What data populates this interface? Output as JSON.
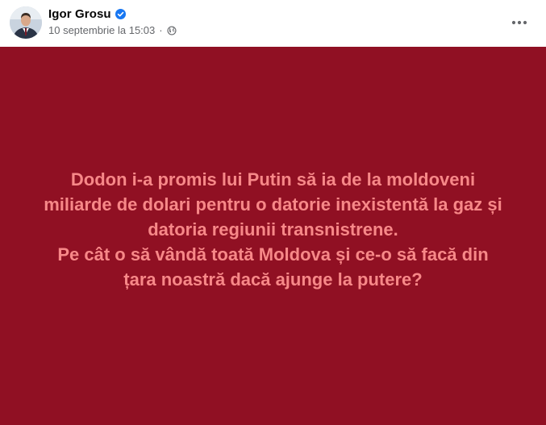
{
  "author": {
    "name": "Igor Grosu",
    "verified": true
  },
  "post": {
    "timestamp": "10 septembrie la 15:03",
    "separator": "·",
    "privacy_icon": "globe-icon"
  },
  "menu": {
    "icon": "more-horizontal-icon"
  },
  "message": {
    "lines": [
      "Dodon i-a promis lui Putin să ia de la moldoveni",
      "miliarde de dolari pentru o datorie inexistentă la gaz și",
      "datoria regiunii transnistrene.",
      "Pe cât o să vândă toată Moldova și ce-o să facă din",
      "țara noastră dacă ajunge la putere?"
    ]
  },
  "colors": {
    "background": "#901023",
    "text": "#f78888",
    "verified": "#1877f2",
    "meta_text": "#65676b"
  }
}
